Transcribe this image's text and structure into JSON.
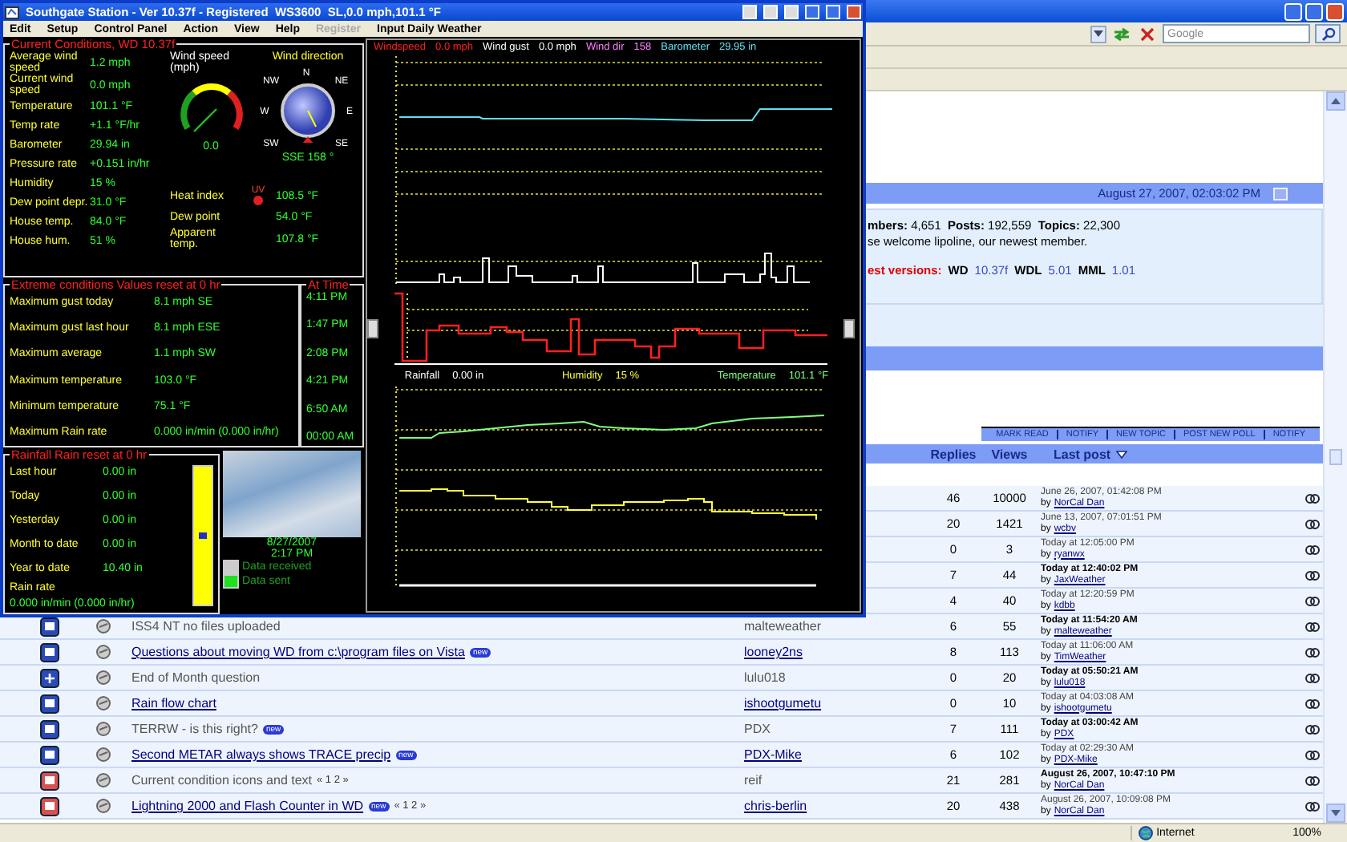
{
  "weather": {
    "title": "Southgate Station - Ver 10.37f - Registered  WS3600  SL,0.0 mph,101.1 °F",
    "menu": [
      {
        "label": "Edit",
        "disabled": false
      },
      {
        "label": "Setup",
        "disabled": false
      },
      {
        "label": "Control Panel",
        "disabled": false
      },
      {
        "label": "Action",
        "disabled": false
      },
      {
        "label": "View",
        "disabled": false
      },
      {
        "label": "Help",
        "disabled": false
      },
      {
        "label": "Register",
        "disabled": true
      },
      {
        "label": "Input Daily Weather",
        "disabled": false
      }
    ],
    "current": {
      "heading": "Current Conditions, WD 10.37f",
      "rows": [
        {
          "label": "Average wind speed",
          "value": "1.2 mph"
        },
        {
          "label": "Current wind speed",
          "value": "0.0 mph"
        },
        {
          "label": "Temperature",
          "value": "101.1 °F"
        },
        {
          "label": "Temp rate",
          "value": "+1.1 °F/hr"
        },
        {
          "label": "Barometer",
          "value": "29.94 in"
        },
        {
          "label": "Pressure rate",
          "value": "+0.151 in/hr"
        },
        {
          "label": "Humidity",
          "value": "15 %"
        },
        {
          "label": "Dew point depr.",
          "value": "31.0 °F"
        },
        {
          "label": "House temp.",
          "value": "84.0 °F"
        },
        {
          "label": "House hum.",
          "value": "51 %"
        }
      ],
      "gauge": {
        "title": "Wind speed (mph)",
        "reading": "0.0"
      },
      "compass": {
        "title": "Wind direction",
        "points": [
          "N",
          "NE",
          "NW",
          "W",
          "E",
          "SW",
          "SE"
        ],
        "reading": "SSE 158 °"
      },
      "uv": "UV",
      "extra": [
        {
          "label": "Heat index",
          "value": "108.5 °F"
        },
        {
          "label": "Dew point",
          "value": "54.0 °F"
        },
        {
          "label": "Apparent temp.",
          "value": "107.8 °F"
        }
      ]
    },
    "extremes": {
      "heading": "Extreme conditions",
      "reset": "Values reset at 0 hr",
      "time_heading": "At Time",
      "rows": [
        {
          "label": "Maximum gust today",
          "value": "8.1 mph SE",
          "time": "4:11 PM"
        },
        {
          "label": "Maximum gust last hour",
          "value": "8.1 mph ESE",
          "time": "1:47 PM"
        },
        {
          "label": "Maximum average",
          "value": "1.1 mph SW",
          "time": "2:08 PM"
        },
        {
          "label": "Maximum temperature",
          "value": "103.0 °F",
          "time": "4:21 PM"
        },
        {
          "label": "Minimum temperature",
          "value": "75.1 °F",
          "time": "6:50 AM"
        },
        {
          "label": "Maximum Rain rate",
          "value": "0.000 in/min (0.000 in/hr)",
          "time": "00:00 AM"
        }
      ]
    },
    "rainfall": {
      "heading": "Rainfall",
      "reset": "Rain reset at 0 hr",
      "rows": [
        {
          "label": "Last hour",
          "value": "0.00 in"
        },
        {
          "label": "Today",
          "value": "0.00 in"
        },
        {
          "label": "Yesterday",
          "value": "0.00 in"
        },
        {
          "label": "Month to date",
          "value": "0.00 in"
        },
        {
          "label": "Year to date",
          "value": "10.40 in"
        }
      ],
      "rate_label": "Rain rate",
      "rate_value": "0.000 in/min (0.000 in/hr)"
    },
    "sky": {
      "date": "8/27/2007",
      "time": "2:17 PM"
    },
    "indicators": [
      {
        "label": "Data received",
        "on": false
      },
      {
        "label": "Data sent",
        "on": true
      }
    ],
    "graph_legend": [
      {
        "label": "Windspeed",
        "value": "0.0 mph",
        "color": "#ff2020"
      },
      {
        "label": "Wind gust",
        "value": "0.0 mph",
        "color": "#ffffff"
      },
      {
        "label": "Wind dir",
        "value": "158",
        "color": "#ff80ff"
      },
      {
        "label": "Barometer",
        "value": "29.95 in",
        "color": "#60e0f0"
      }
    ],
    "graph_labels": [
      {
        "label": "Rainfall",
        "value": "0.00 in",
        "color": "#ffffff"
      },
      {
        "label": "Humidity",
        "value": "15 %",
        "color": "#ffff40"
      },
      {
        "label": "Temperature",
        "value": "101.1 °F",
        "color": "#80ff80"
      }
    ]
  },
  "browser": {
    "search": {
      "placeholder": "Google"
    },
    "board_date": "August 27, 2007, 02:03:02 PM",
    "stats": [
      "**mbers:** 4,651  **Posts:** 192,559  **Topics:** 22,300",
      "se welcome lipoline, our newest member."
    ],
    "versions": {
      "label": "est versions:",
      "items": [
        {
          "name": "WD",
          "value": "10.37f"
        },
        {
          "name": "WDL",
          "value": "5.01"
        },
        {
          "name": "MML",
          "value": "1.01"
        }
      ]
    },
    "actions": [
      "MARK READ",
      "NOTIFY",
      "NEW TOPIC",
      "POST NEW POLL",
      "NOTIFY"
    ],
    "columns": [
      "Replies",
      "Views",
      "Last post"
    ],
    "topics": [
      {
        "replies": "46",
        "views": "10000",
        "last_post": {
          "date": "June 26, 2007, 01:42:08 PM",
          "by": "by",
          "user": "NorCal Dan",
          "highlighted": false
        }
      },
      {
        "replies": "20",
        "views": "1421",
        "last_post": {
          "date": "June 13, 2007, 07:01:51 PM",
          "by": "by",
          "user": "wcbv",
          "highlighted": false
        }
      },
      {
        "replies": "0",
        "views": "3",
        "last_post": {
          "date": "Today at 12:05:00 PM",
          "by": "by",
          "user": "ryanwx",
          "highlighted": false
        }
      },
      {
        "replies": "7",
        "views": "44",
        "last_post": {
          "date": "Today at 12:40:02 PM",
          "by": "by",
          "user": "JaxWeather",
          "highlighted": true
        }
      },
      {
        "replies": "4",
        "views": "40",
        "last_post": {
          "date": "Today at 12:20:59 PM",
          "by": "by",
          "user": "kdbb",
          "highlighted": false
        }
      },
      {
        "kind": "normal",
        "title": "ISS4 NT no files uploaded",
        "unread": false,
        "author": "malteweather",
        "replies": "6",
        "views": "55",
        "last_post": {
          "date": "Today at 11:54:20 AM",
          "by": "by",
          "user": "malteweather",
          "highlighted": true
        }
      },
      {
        "kind": "normal",
        "title": "Questions about moving WD from c:\\program files on Vista",
        "badge": "new",
        "unread": true,
        "author": "looney2ns",
        "replies": "8",
        "views": "113",
        "last_post": {
          "date": "Today at 11:06:00 AM",
          "by": "by",
          "user": "TimWeather",
          "highlighted": false
        }
      },
      {
        "kind": "locked",
        "title": "End of Month question",
        "unread": false,
        "author": "lulu018",
        "replies": "0",
        "views": "20",
        "last_post": {
          "date": "Today at 05:50:21 AM",
          "by": "by",
          "user": "lulu018",
          "highlighted": true
        }
      },
      {
        "kind": "normal",
        "title": "Rain flow chart",
        "unread": true,
        "author": "ishootgumetu",
        "replies": "0",
        "views": "10",
        "last_post": {
          "date": "Today at 04:03:08 AM",
          "by": "by",
          "user": "ishootgumetu",
          "highlighted": false
        }
      },
      {
        "kind": "normal",
        "title": "TERRW - is this right?",
        "badge": "new",
        "unread": false,
        "author": "PDX",
        "replies": "7",
        "views": "111",
        "last_post": {
          "date": "Today at 03:00:42 AM",
          "by": "by",
          "user": "PDX",
          "highlighted": true
        }
      },
      {
        "kind": "normal",
        "title": "Second METAR always shows TRACE precip",
        "badge": "new",
        "unread": true,
        "author": "PDX-Mike",
        "replies": "6",
        "views": "102",
        "last_post": {
          "date": "Today at 02:29:30 AM",
          "by": "by",
          "user": "PDX-Mike",
          "highlighted": false
        }
      },
      {
        "kind": "hot",
        "title": "Current condition icons and text",
        "pages": "« 1 2 »",
        "unread": false,
        "author": "reif",
        "replies": "21",
        "views": "281",
        "last_post": {
          "date": "August 26, 2007, 10:47:10 PM",
          "by": "by",
          "user": "NorCal Dan",
          "highlighted": true
        }
      },
      {
        "kind": "hot",
        "title": "Lightning 2000 and Flash Counter in WD",
        "badge": "new",
        "pages": "« 1 2 »",
        "unread": true,
        "author": "chris-berlin",
        "replies": "20",
        "views": "438",
        "last_post": {
          "date": "August 26, 2007, 10:09:08 PM",
          "by": "by",
          "user": "NorCal Dan",
          "highlighted": false
        }
      }
    ],
    "status_bar": {
      "zone": "Internet",
      "zoom": "100%"
    }
  }
}
